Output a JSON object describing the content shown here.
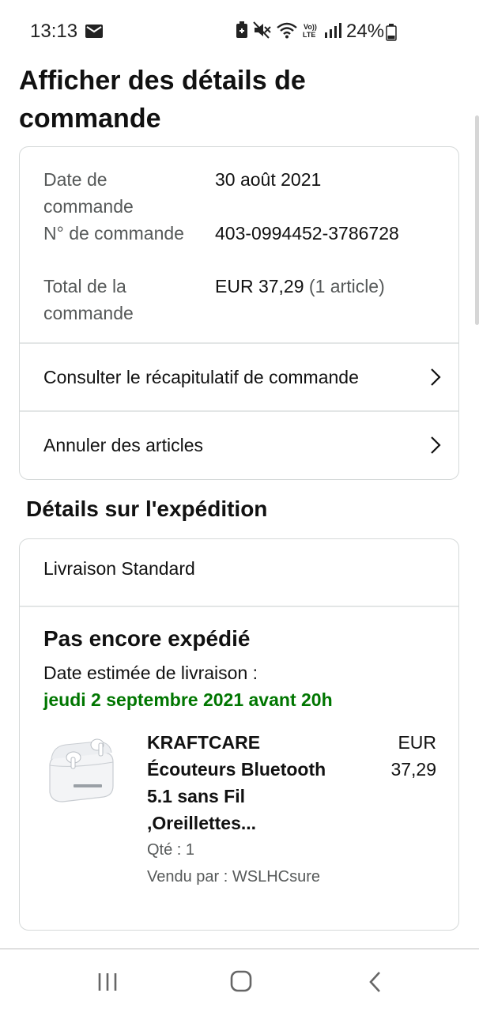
{
  "status_bar": {
    "time": "13:13",
    "battery_percent": "24%",
    "icons": [
      "mail-icon",
      "battery-saver-icon",
      "mute-icon",
      "wifi-icon",
      "volte-icon",
      "signal-icon",
      "battery-icon"
    ]
  },
  "page": {
    "title": "Afficher des détails de commande"
  },
  "order_summary": {
    "date_label": "Date de commande",
    "date_value": "30 août 2021",
    "number_label": "N° de commande",
    "number_value": "403-0994452-3786728",
    "total_label": "Total de la commande",
    "total_value": "EUR 37,29",
    "total_count": "(1 article)",
    "links": [
      {
        "label": "Consulter le récapitulatif de commande"
      },
      {
        "label": "Annuler des articles"
      }
    ]
  },
  "shipping": {
    "section_title": "Détails sur l'expédition",
    "method": "Livraison Standard",
    "status": "Pas encore expédié",
    "estimate_label": "Date estimée de livraison :",
    "estimate_date": "jeudi 2 septembre 2021 avant 20h",
    "item": {
      "name": "KRAFTCARE Écouteurs Bluetooth 5.1 sans Fil ,Oreillettes...",
      "price": "EUR 37,29",
      "quantity": "Qté : 1",
      "seller": "Vendu par : WSLHCsure",
      "image_brand": "KRAFTCARE"
    }
  },
  "colors": {
    "delivery_green": "#007600",
    "border": "#d5d9d9",
    "muted_text": "#565959"
  }
}
